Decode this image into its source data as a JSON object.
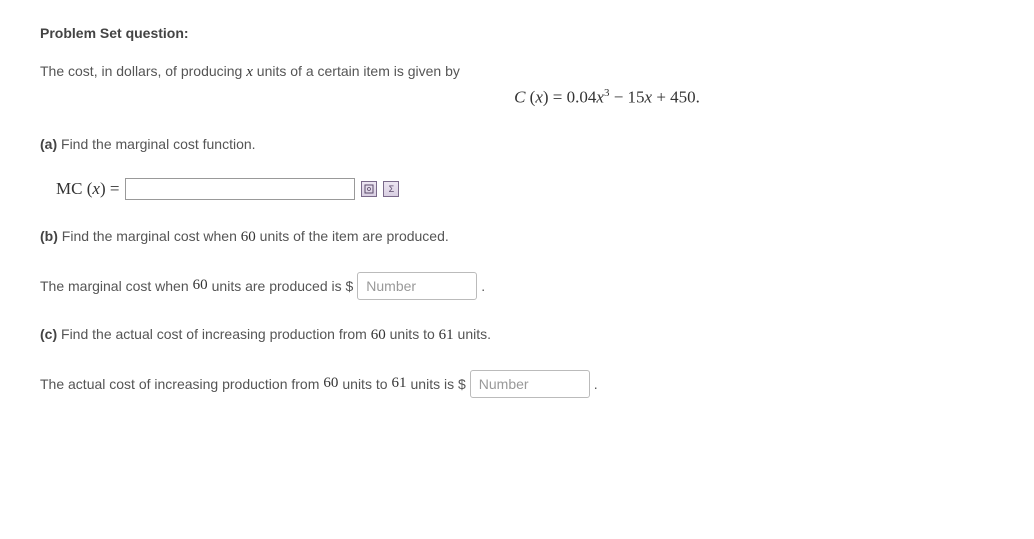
{
  "heading": "Problem Set question:",
  "intro": {
    "pre": "The cost, in dollars, of producing ",
    "var": "x",
    "post": " units of a certain item is given by"
  },
  "equation": {
    "lhs_func": "C",
    "lhs_arg": "x",
    "coef1": "0.04",
    "var1": "x",
    "exp1": "3",
    "coef2": "15",
    "var2": "x",
    "const": "450"
  },
  "partA": {
    "label": "(a)",
    "text": " Find the marginal cost function.",
    "mc_prefix": "MC",
    "mc_arg": "x",
    "equals": " ="
  },
  "icons": {
    "preview": "�⃞",
    "sigma": "Σ"
  },
  "partB": {
    "label": "(b)",
    "pre": " Find the marginal cost when ",
    "num": "60",
    "post": " units of the item are produced."
  },
  "partB_answer": {
    "pre": "The marginal cost when ",
    "num": "60",
    "mid": " units are produced is $",
    "placeholder": "Number",
    "after": "."
  },
  "partC": {
    "label": "(c)",
    "pre": " Find the actual cost of increasing production from ",
    "n1": "60",
    "mid": " units to ",
    "n2": "61",
    "post": " units."
  },
  "partC_answer": {
    "pre": "The actual cost of increasing production from ",
    "n1": "60",
    "mid1": " units to ",
    "n2": "61",
    "mid2": " units is $",
    "placeholder": "Number",
    "after": "."
  }
}
